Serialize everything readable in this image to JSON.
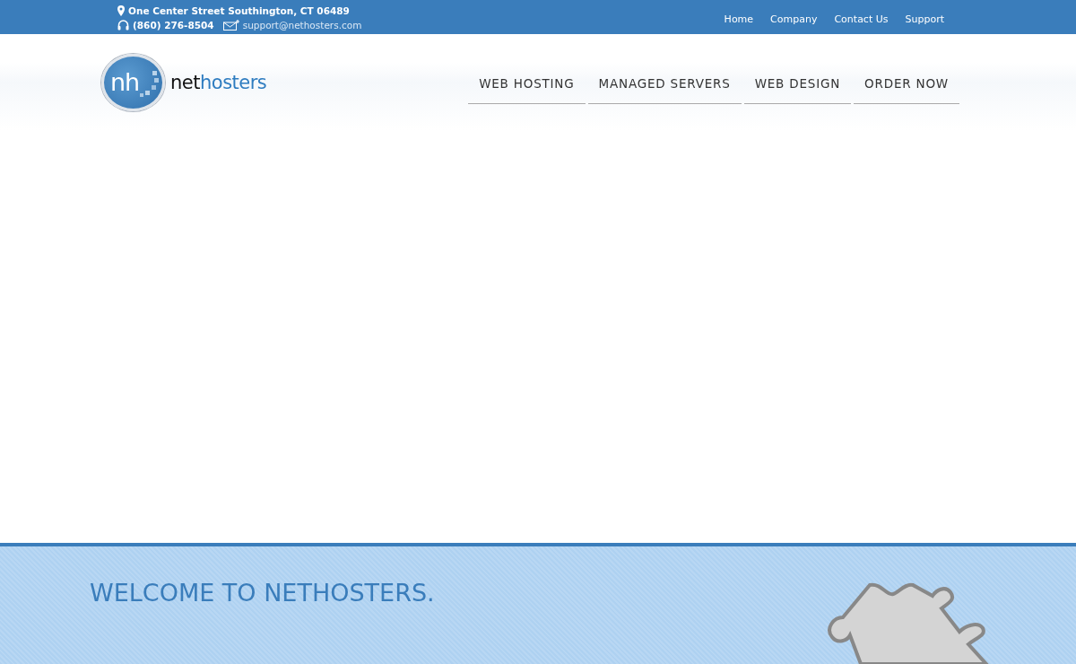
{
  "top_bar": {
    "address": "One Center Street Southington, CT 06489",
    "phone": "(860) 276-8504",
    "email": "support@nethosters.com",
    "links": [
      "Home",
      "Company",
      "Contact Us",
      "Support"
    ]
  },
  "logo": {
    "mark": "nh",
    "name_part_1": "net",
    "name_part_2": "hosters"
  },
  "main_nav": [
    {
      "label": "WEB HOSTING"
    },
    {
      "label": "MANAGED SERVERS"
    },
    {
      "label": "WEB DESIGN"
    },
    {
      "label": "ORDER NOW"
    }
  ],
  "welcome": {
    "heading": "WELCOME TO NETHOSTERS."
  }
}
